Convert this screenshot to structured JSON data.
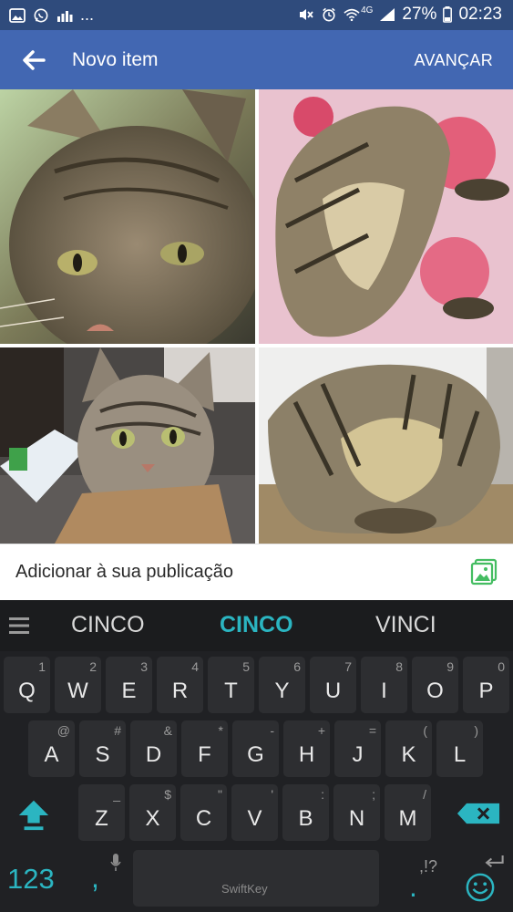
{
  "status_bar": {
    "left_icons": [
      "gallery-icon",
      "whatsapp-icon",
      "signal-bars-icon"
    ],
    "more": "...",
    "right_icons": [
      "mute-icon",
      "alarm-icon",
      "wifi-icon",
      "signal-icon",
      "battery-icon"
    ],
    "network_label": "4G",
    "battery": "27%",
    "time": "02:23"
  },
  "app_bar": {
    "back_icon": "arrow-left-icon",
    "title": "Novo item",
    "next_label": "AVANÇAR",
    "color": "#4267b2"
  },
  "photos": [
    {
      "name": "photo-cat-closeup"
    },
    {
      "name": "photo-cat-belly-pink"
    },
    {
      "name": "photo-cat-in-box"
    },
    {
      "name": "photo-cat-curled"
    }
  ],
  "add_bar": {
    "label": "Adicionar à sua publicação",
    "icon": "add-photo-icon"
  },
  "keyboard": {
    "suggestions": [
      "CINCO",
      "CINCO",
      "VINCI"
    ],
    "row1": [
      {
        "m": "Q",
        "h": "1"
      },
      {
        "m": "W",
        "h": "2"
      },
      {
        "m": "E",
        "h": "3"
      },
      {
        "m": "R",
        "h": "4"
      },
      {
        "m": "T",
        "h": "5"
      },
      {
        "m": "Y",
        "h": "6"
      },
      {
        "m": "U",
        "h": "7"
      },
      {
        "m": "I",
        "h": "8"
      },
      {
        "m": "O",
        "h": "9"
      },
      {
        "m": "P",
        "h": "0"
      }
    ],
    "row2": [
      {
        "m": "A",
        "h": "@"
      },
      {
        "m": "S",
        "h": "#"
      },
      {
        "m": "D",
        "h": "&"
      },
      {
        "m": "F",
        "h": "*"
      },
      {
        "m": "G",
        "h": "-"
      },
      {
        "m": "H",
        "h": "+"
      },
      {
        "m": "J",
        "h": "="
      },
      {
        "m": "K",
        "h": "("
      },
      {
        "m": "L",
        "h": ")"
      }
    ],
    "row3": [
      {
        "m": "Z",
        "h": "_"
      },
      {
        "m": "X",
        "h": "$"
      },
      {
        "m": "C",
        "h": "\""
      },
      {
        "m": "V",
        "h": "'"
      },
      {
        "m": "B",
        "h": ":"
      },
      {
        "m": "N",
        "h": ";"
      },
      {
        "m": "M",
        "h": "/"
      }
    ],
    "numbers_key": "123",
    "comma_key": ",",
    "period_key": ".",
    "punct_hint": ",!?",
    "space_label": "SwiftKey",
    "accent": "#2bb5c1"
  }
}
